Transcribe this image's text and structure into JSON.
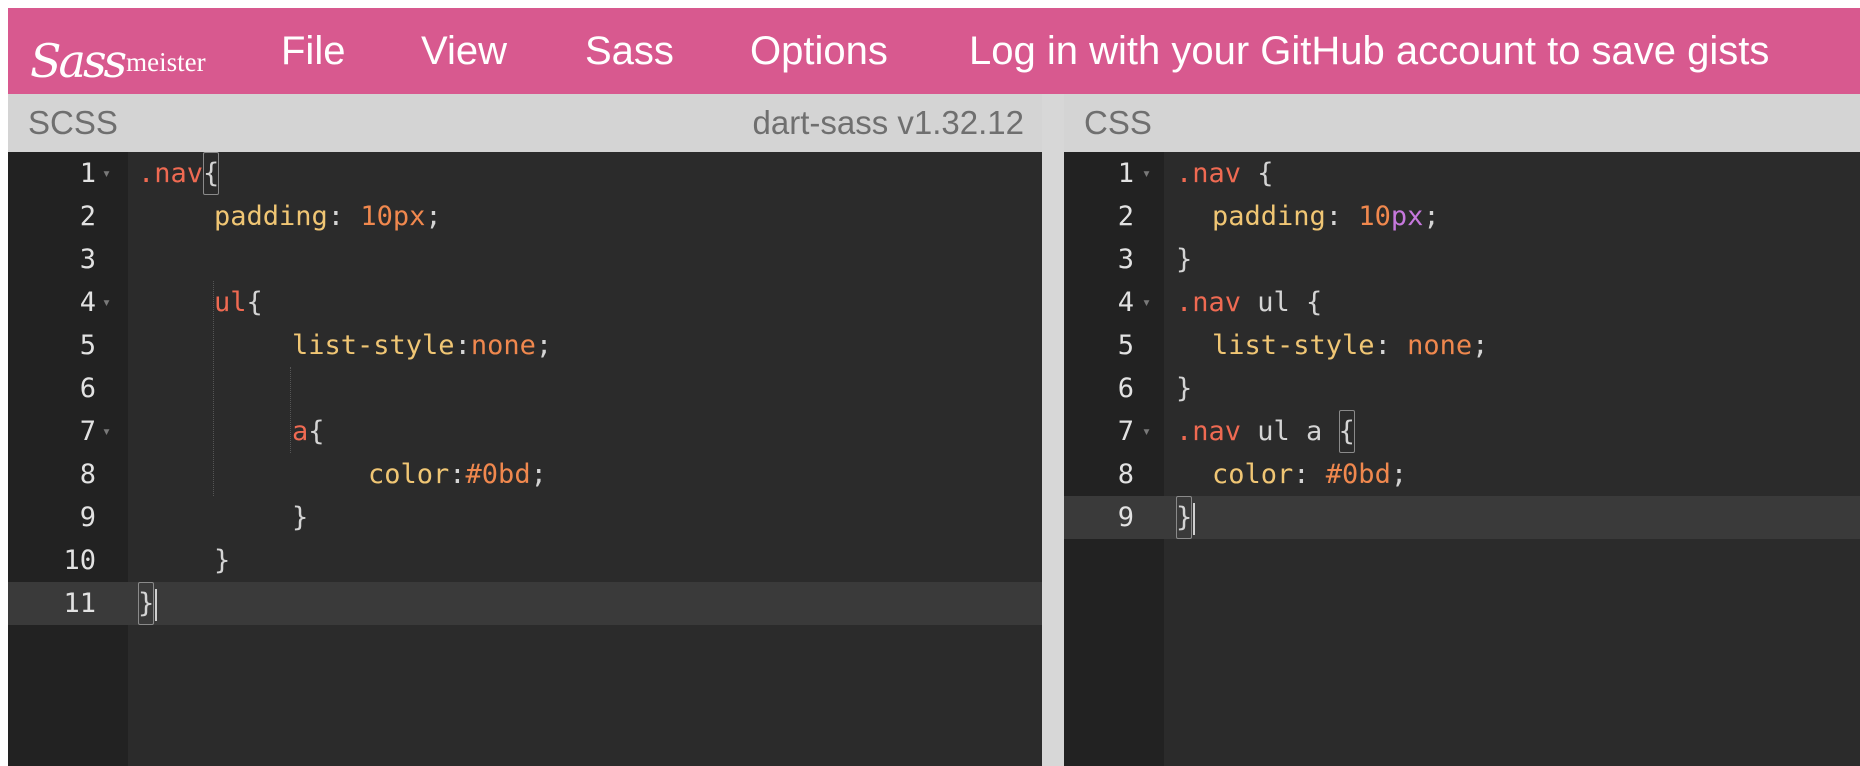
{
  "header": {
    "logo_script": "Sass",
    "logo_text": "meister",
    "menu": [
      "File",
      "View",
      "Sass",
      "Options"
    ],
    "login_text": "Log in with your GitHub account to save gists",
    "bg_color": "#d8598f"
  },
  "scss_pane": {
    "title": "SCSS",
    "version": "dart-sass v1.32.12",
    "lines": [
      {
        "n": "1",
        "fold": true
      },
      {
        "n": "2"
      },
      {
        "n": "3"
      },
      {
        "n": "4",
        "fold": true
      },
      {
        "n": "5"
      },
      {
        "n": "6"
      },
      {
        "n": "7",
        "fold": true
      },
      {
        "n": "8"
      },
      {
        "n": "9"
      },
      {
        "n": "10"
      },
      {
        "n": "11"
      }
    ],
    "tokens": {
      "l1_sel": ".nav",
      "l1_brace": "{",
      "l2_prop": "padding",
      "l2_colon": ": ",
      "l2_num": "10",
      "l2_unit": "px",
      "l2_semi": ";",
      "l4_sel": "ul",
      "l4_brace": "{",
      "l5_prop": "list-style",
      "l5_colon": ":",
      "l5_val": "none",
      "l5_semi": ";",
      "l7_sel": "a",
      "l7_brace": "{",
      "l8_prop": "color",
      "l8_colon": ":",
      "l8_val": "#0bd",
      "l8_semi": ";",
      "l9_brace": "}",
      "l10_brace": "}",
      "l11_brace": "}"
    }
  },
  "css_pane": {
    "title": "CSS",
    "lines": [
      {
        "n": "1",
        "fold": true
      },
      {
        "n": "2"
      },
      {
        "n": "3"
      },
      {
        "n": "4",
        "fold": true
      },
      {
        "n": "5"
      },
      {
        "n": "6"
      },
      {
        "n": "7",
        "fold": true
      },
      {
        "n": "8"
      },
      {
        "n": "9"
      }
    ],
    "tokens": {
      "l1_sel": ".nav",
      "l1_brace": " {",
      "l2_prop": "padding",
      "l2_colon": ": ",
      "l2_num": "10",
      "l2_unit": "px",
      "l2_semi": ";",
      "l3_brace": "}",
      "l4_sel": ".nav",
      "l4_rest": " ul {",
      "l5_prop": "list-style",
      "l5_colon": ": ",
      "l5_val": "none",
      "l5_semi": ";",
      "l6_brace": "}",
      "l7_sel": ".nav",
      "l7_rest": " ul a ",
      "l7_brace": "{",
      "l8_prop": "color",
      "l8_colon": ": ",
      "l8_val": "#0bd",
      "l8_semi": ";",
      "l9_brace": "}"
    }
  },
  "fold_icon": "chevron-down-icon",
  "syntax_colors": {
    "selector": "#ef6a52",
    "property": "#f0c674",
    "value": "#f0884e",
    "unit": "#c678dd",
    "editor_bg": "#2b2b2b"
  }
}
